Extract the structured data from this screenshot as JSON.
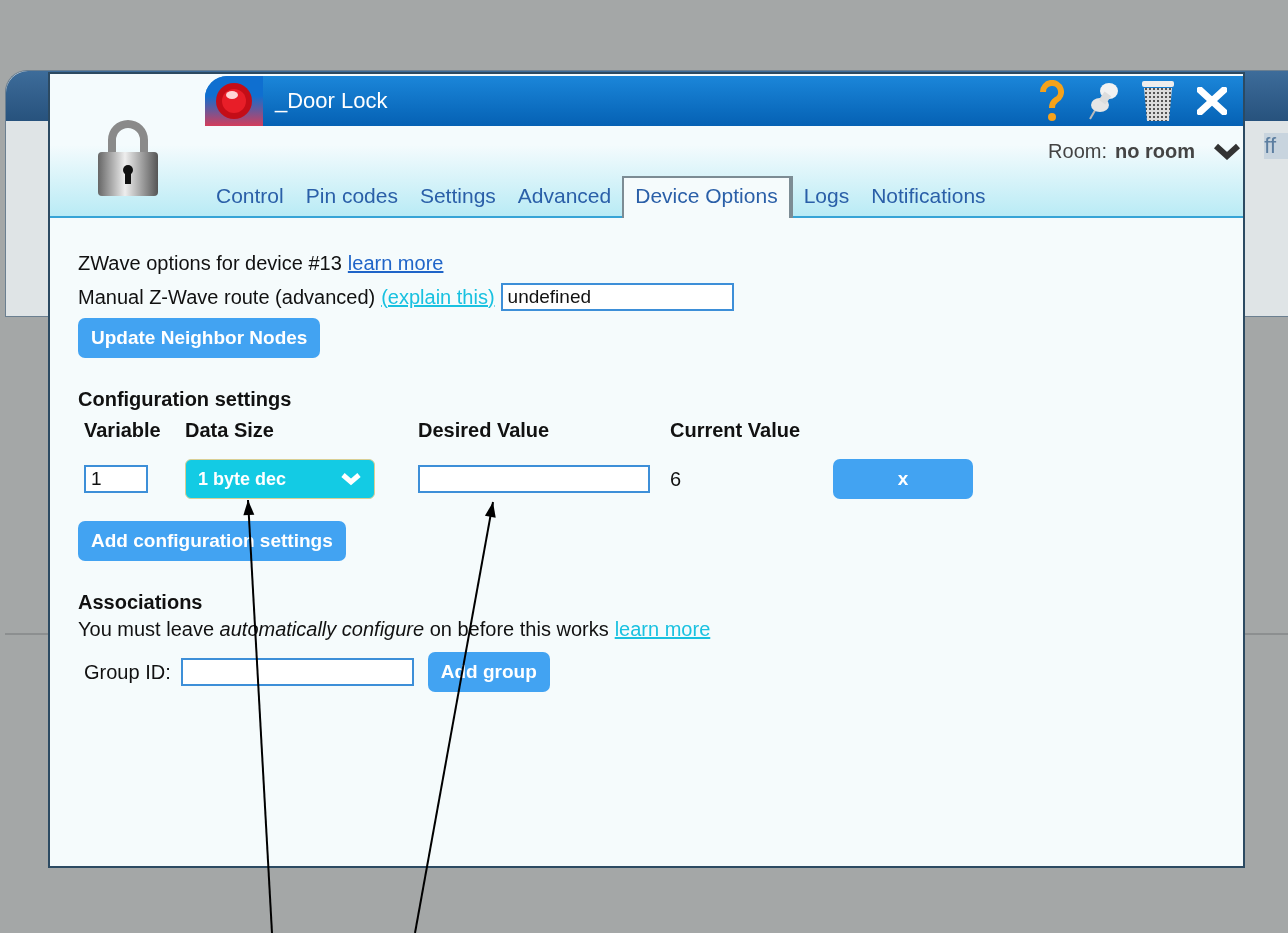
{
  "background_window": {
    "button_text": "ff"
  },
  "dialog": {
    "title": "_Door Lock",
    "room": {
      "label": "Room:",
      "value": "no room"
    },
    "tabs": [
      {
        "label": "Control",
        "selected": false
      },
      {
        "label": "Pin codes",
        "selected": false
      },
      {
        "label": "Settings",
        "selected": false
      },
      {
        "label": "Advanced",
        "selected": false
      },
      {
        "label": "Device Options",
        "selected": true
      },
      {
        "label": "Logs",
        "selected": false
      },
      {
        "label": "Notifications",
        "selected": false
      }
    ],
    "zwave_options": {
      "text": "ZWave options for device #13",
      "link": "learn more"
    },
    "route": {
      "label": "Manual Z-Wave route (advanced)",
      "link": "(explain this)",
      "value": "undefined"
    },
    "update_button": "Update Neighbor Nodes",
    "configuration": {
      "heading": "Configuration settings",
      "columns": [
        "Variable",
        "Data Size",
        "Desired Value",
        "Current Value"
      ],
      "rows": [
        {
          "variable": "1",
          "data_size": "1 byte dec",
          "current_value": "6",
          "remove_button": "x"
        }
      ],
      "add_button": "Add configuration settings"
    },
    "associations": {
      "heading": "Associations",
      "note": "You must leave *automatically configure* on before this works",
      "link": "learn more",
      "group_label": "Group ID:",
      "add_button": "Add group"
    }
  }
}
